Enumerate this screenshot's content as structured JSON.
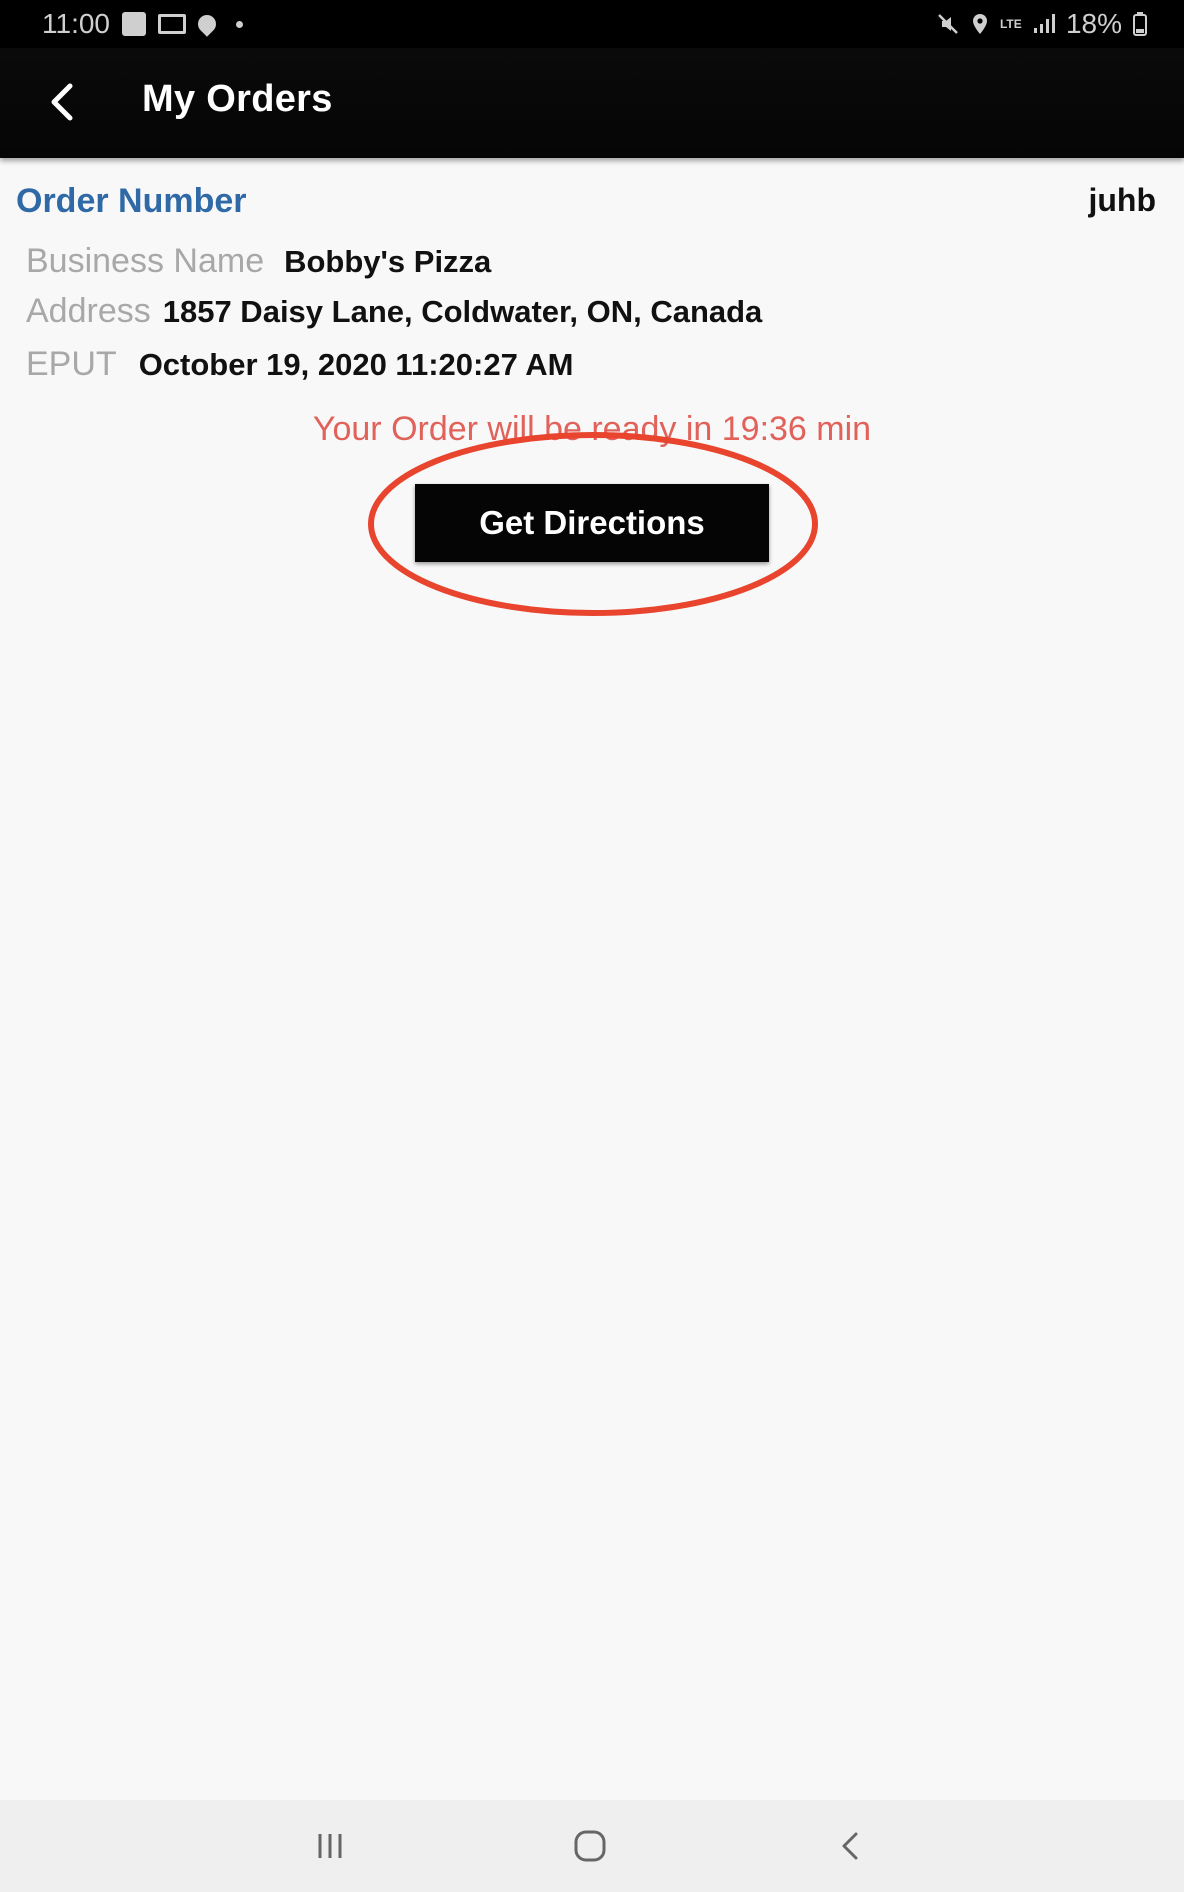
{
  "status_bar": {
    "time": "11:00",
    "battery": "18%",
    "network": "LTE"
  },
  "app_bar": {
    "title": "My Orders",
    "back_icon": "back-arrow-icon"
  },
  "order": {
    "number_label": "Order Number",
    "number_value": "juhb",
    "business_label": "Business Name",
    "business_value": "Bobby's Pizza",
    "address_label": "Address",
    "address_value": "1857 Daisy Lane, Coldwater, ON, Canada",
    "eput_label": "EPUT",
    "eput_value": "October 19, 2020 11:20:27 AM",
    "ready_message": "Your Order will be ready in 19:36 min"
  },
  "actions": {
    "directions_label": "Get Directions"
  },
  "colors": {
    "accent_blue": "#2f6aa6",
    "alert_red": "#e0625a",
    "highlight_circle": "#e8442e"
  },
  "nav_bar": {
    "icons": [
      "recent-apps-icon",
      "home-icon",
      "back-icon"
    ]
  }
}
